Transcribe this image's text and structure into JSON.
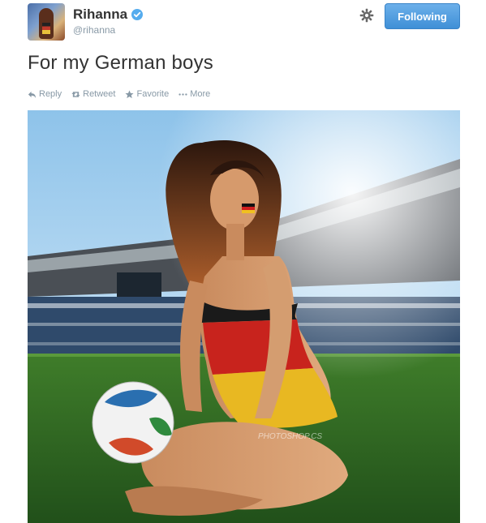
{
  "user": {
    "name": "Rihanna",
    "handle": "@rihanna",
    "verified": true,
    "avatar_icon": "profile-photo"
  },
  "header": {
    "follow_label": "Following",
    "settings_icon": "gear-icon"
  },
  "tweet": {
    "text": "For my German boys"
  },
  "actions": [
    {
      "label": "Reply",
      "icon": "reply-icon"
    },
    {
      "label": "Retweet",
      "icon": "retweet-icon"
    },
    {
      "label": "Favorite",
      "icon": "star-icon"
    },
    {
      "label": "More",
      "icon": "more-icon"
    }
  ],
  "photo": {
    "watermark": "PHOTOSHOP.CS"
  },
  "colors": {
    "accent": "#3f8fd6",
    "muted": "#8899a6",
    "text": "#333333"
  }
}
